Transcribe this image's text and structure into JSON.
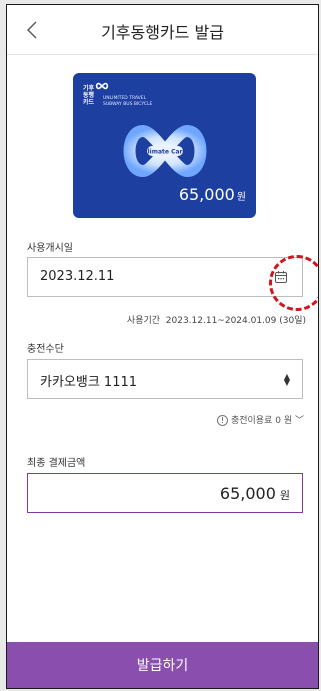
{
  "header": {
    "title": "기후동행카드 발급",
    "back_icon": "chevron-left-icon"
  },
  "card": {
    "brand_ko_1": "기후",
    "brand_ko_2": "동행",
    "brand_ko_3": "카드",
    "brand_en_1": "UNLIMITED TRAVEL",
    "brand_en_2": "SUBWAY BUS BICYCLE",
    "center_text": "Climate Card",
    "amount": "65,000",
    "currency": "원",
    "color": "#1d3f9f"
  },
  "start_date": {
    "label": "사용개시일",
    "value": "2023.12.11",
    "icon": "calendar-icon",
    "period_label": "사용기간",
    "period_value": "2023.12.11~2024.01.09 (30일)"
  },
  "payment_method": {
    "label": "충전수단",
    "value": "카카오뱅크 1111",
    "fee_text": "충전이용료 0 원"
  },
  "final_amount": {
    "label": "최종 결제금액",
    "amount": "65,000",
    "currency": "원"
  },
  "submit": {
    "label": "발급하기",
    "color": "#8a4fae"
  }
}
